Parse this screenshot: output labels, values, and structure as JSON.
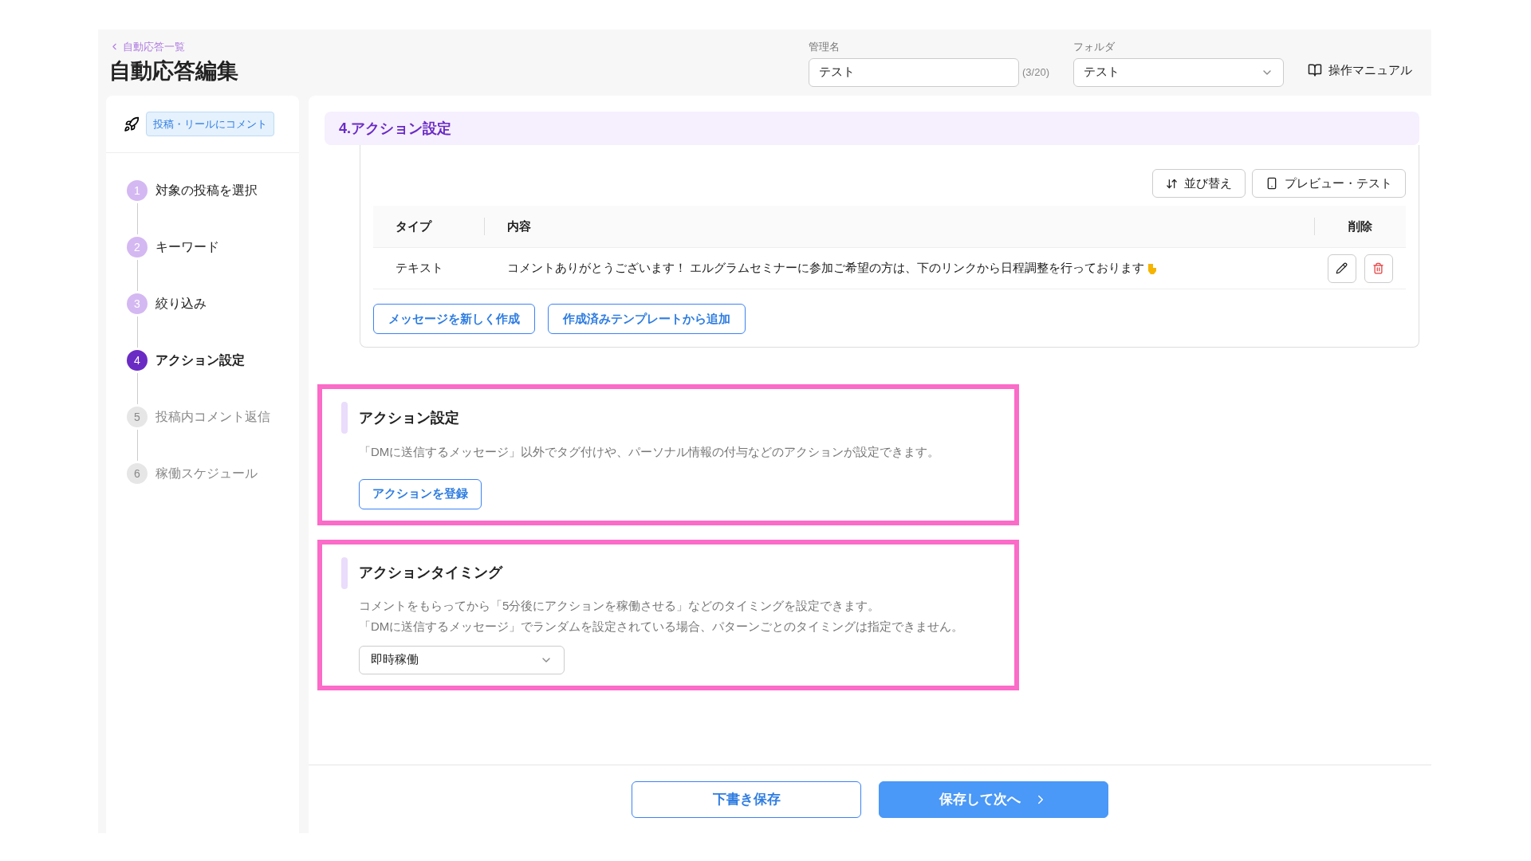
{
  "breadcrumb": "自動応答一覧",
  "page_title": "自動応答編集",
  "name_field": {
    "label": "管理名",
    "value": "テスト",
    "counter": "(3/20)"
  },
  "folder_field": {
    "label": "フォルダ",
    "value": "テスト"
  },
  "manual_link": "操作マニュアル",
  "trigger_badge": "投稿・リールにコメント",
  "steps": [
    {
      "number": "1",
      "label": "対象の投稿を選択",
      "kind": "done"
    },
    {
      "number": "2",
      "label": "キーワード",
      "kind": "done"
    },
    {
      "number": "3",
      "label": "絞り込み",
      "kind": "done"
    },
    {
      "number": "4",
      "label": "アクション設定",
      "kind": "current"
    },
    {
      "number": "5",
      "label": "投稿内コメント返信",
      "kind": "pending"
    },
    {
      "number": "6",
      "label": "稼働スケジュール",
      "kind": "pending"
    }
  ],
  "section_title": "4.アクション設定",
  "toolbar": [
    "並び替え",
    "プレビュー・テスト"
  ],
  "table": {
    "columns": [
      "タイプ",
      "内容",
      "削除"
    ],
    "rows": [
      {
        "type": "テキスト",
        "content": "コメントありがとうございます！ エルグラムセミナーに参加ご希望の方は、下のリンクから日程調整を行っております"
      }
    ]
  },
  "message_buttons": [
    "メッセージを新しく作成",
    "作成済みテンプレートから追加"
  ],
  "action_setting": {
    "title": "アクション設定",
    "description": "「DMに送信するメッセージ」以外でタグ付けや、パーソナル情報の付与などのアクションが設定できます。",
    "button": "アクションを登録"
  },
  "action_timing": {
    "title": "アクションタイミング",
    "description": [
      "コメントをもらってから「5分後にアクションを稼働させる」などのタイミングを設定できます。",
      "「DMに送信するメッセージ」でランダムを設定されている場合、パターンごとのタイミングは指定できません。"
    ],
    "value": "即時稼働"
  },
  "footer_buttons": [
    {
      "label": "下書き保存",
      "kind": "outline"
    },
    {
      "label": "保存して次へ",
      "kind": "primary"
    }
  ]
}
